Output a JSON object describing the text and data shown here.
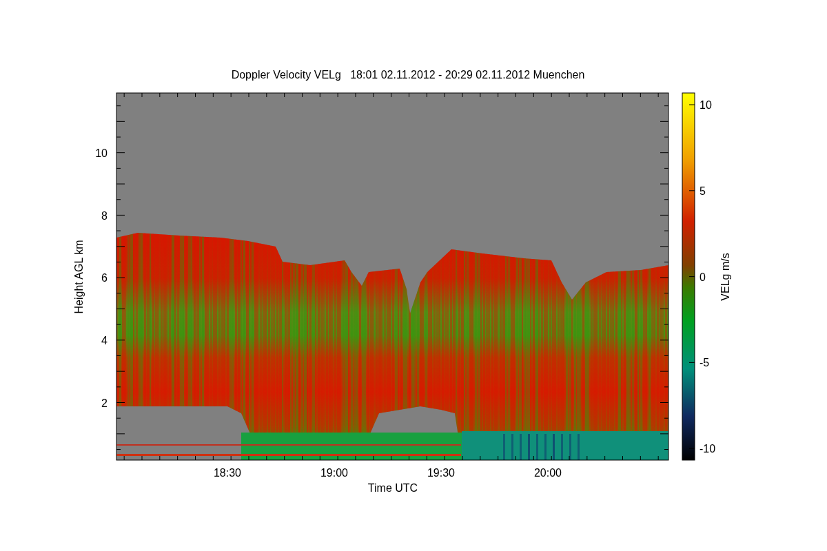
{
  "chart": {
    "title": "Doppler Velocity VELg   18:01 02.11.2012 - 20:29 02.11.2012 Muenchen",
    "ylabel": "Height AGL km",
    "xlabel": "Time UTC",
    "yticks": [
      "10",
      "8",
      "6",
      "4",
      "2"
    ],
    "xticks": [
      "18:30",
      "19:00",
      "19:30",
      "20:00"
    ]
  },
  "colorbar": {
    "label": "VELg m/s",
    "ticks": [
      "10",
      "5",
      "0",
      "-5",
      "-10"
    ]
  }
}
